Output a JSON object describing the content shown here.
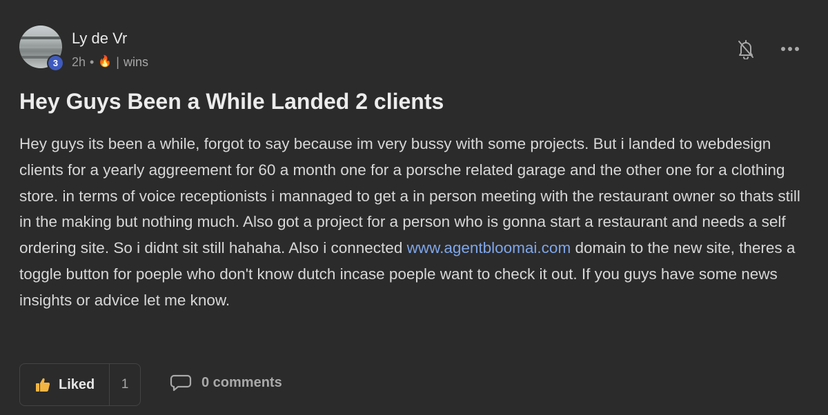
{
  "author": {
    "name": "Ly de Vr",
    "level": "3",
    "time": "2h",
    "separator": "•",
    "streak_icon": "🔥",
    "divider": "|",
    "category": "wins"
  },
  "header_icons": {
    "bell": "bell-off-icon",
    "more": "more-horizontal-icon"
  },
  "post": {
    "title": "Hey Guys Been a While Landed 2 clients",
    "body_part1": "Hey guys its been a while, forgot to say because im very bussy with some projects. But i landed to webdesign clients for a yearly aggreement for 60 a month one for a porsche related garage and the other one for a clothing store. in terms of voice receptionists i mannaged to get a in person meeting with the restaurant owner so thats still in the making but nothing much. Also got a project for a person who is gonna start a restaurant and needs a self ordering site. So i didnt sit still hahaha. Also i connected ",
    "link_text": "www.agentbloomai.com",
    "body_part2": " domain to the new site, theres a toggle button for poeple who don't know dutch incase poeple want to check it out. If you guys have some news insights or advice let me know."
  },
  "footer": {
    "like_label": "Liked",
    "like_count": "1",
    "comments_label": "0 comments"
  },
  "colors": {
    "background": "#2b2b2b",
    "link": "#7ea6ea",
    "level_badge": "#3f5bbf",
    "like_icon": "#f2b544"
  }
}
